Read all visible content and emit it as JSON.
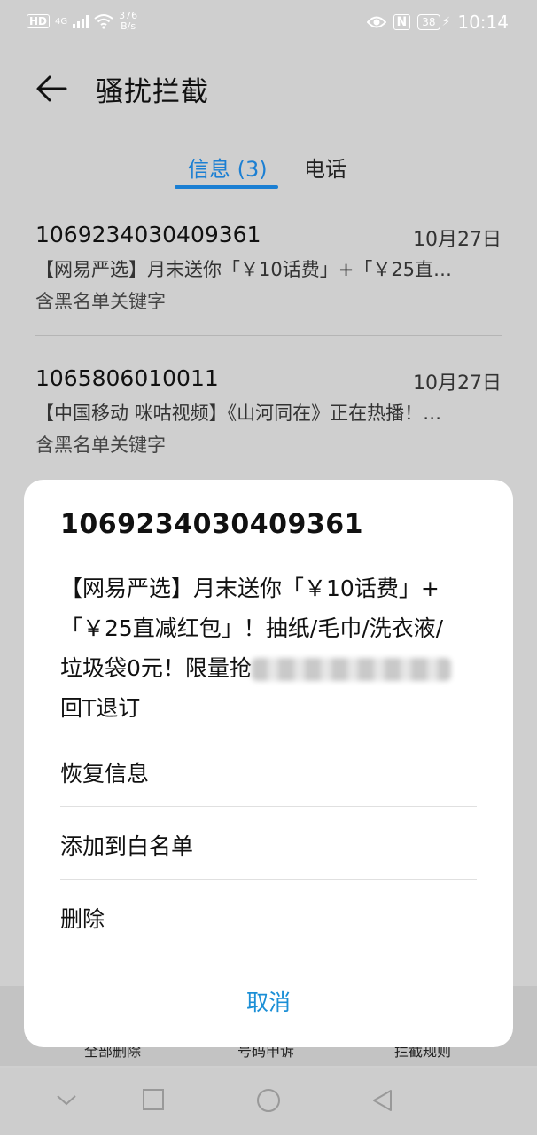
{
  "status_bar": {
    "hd": "HD",
    "network": "4G",
    "speed_value": "376",
    "speed_unit": "B/s",
    "nfc": "N",
    "battery": "38",
    "time": "10:14"
  },
  "app_bar": {
    "title": "骚扰拦截"
  },
  "tabs": [
    {
      "label": "信息 (3)",
      "selected": true
    },
    {
      "label": "电话",
      "selected": false
    }
  ],
  "messages": [
    {
      "number": "1069234030409361",
      "date": "10月27日",
      "preview": "【网易严选】月末送你「￥10话费」+「￥25直…",
      "tag": "含黑名单关键字"
    },
    {
      "number": "1065806010011",
      "date": "10月27日",
      "preview": "【中国移动 咪咕视频】《山河同在》正在热播！…",
      "tag": "含黑名单关键字"
    }
  ],
  "bottom_bar": {
    "delete_all": "全部删除",
    "number_appeal": "号码申诉",
    "intercept_rules": "拦截规则"
  },
  "dialog": {
    "title": "1069234030409361",
    "body_line1": "【网易严选】月末送你「￥10话费」+",
    "body_line2": "「￥25直减红包」！抽纸/毛巾/洗衣液/",
    "body_line3": "垃圾袋0元！限量抢",
    "body_line4": "回T退订",
    "actions": [
      {
        "label": "恢复信息"
      },
      {
        "label": "添加到白名单"
      },
      {
        "label": "删除"
      }
    ],
    "cancel": "取消"
  },
  "colors": {
    "accent": "#1b7fd3",
    "cancel": "#1b8fd6",
    "dim_background": "#cfcfcf"
  }
}
